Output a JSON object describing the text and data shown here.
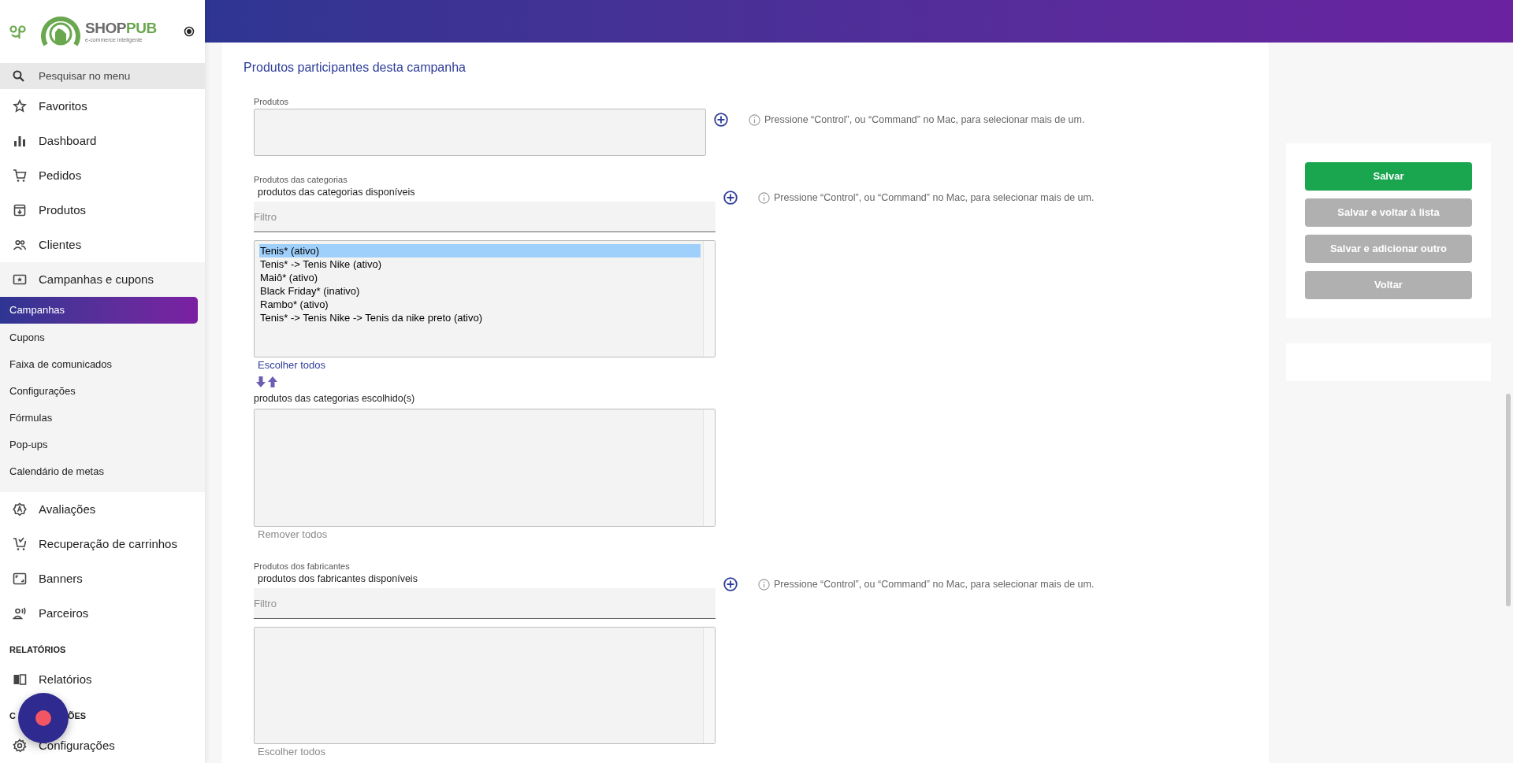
{
  "brand": {
    "name_parts": [
      {
        "text": "SHOP",
        "color": "#6b6b6b"
      },
      {
        "text": "PUB",
        "color": "#6aa84f"
      }
    ],
    "tagline": "e-commerce inteligente"
  },
  "sidebar": {
    "search_placeholder": "Pesquisar no menu",
    "entries": [
      {
        "kind": "item",
        "label": "Favoritos"
      },
      {
        "kind": "item",
        "label": "Dashboard"
      },
      {
        "kind": "item",
        "label": "Pedidos"
      },
      {
        "kind": "item",
        "label": "Produtos"
      },
      {
        "kind": "item",
        "label": "Clientes"
      },
      {
        "kind": "item",
        "label": "Campanhas e cupons",
        "expanded": true,
        "children": [
          {
            "label": "Campanhas",
            "selected": true
          },
          {
            "label": "Cupons",
            "selected": false
          },
          {
            "label": "Faixa de comunicados",
            "selected": false
          },
          {
            "label": "Configurações",
            "selected": false
          },
          {
            "label": "Fórmulas",
            "selected": false
          },
          {
            "label": "Pop-ups",
            "selected": false
          },
          {
            "label": "Calendário de metas",
            "selected": false
          }
        ]
      },
      {
        "kind": "item",
        "label": "Avaliações"
      },
      {
        "kind": "item",
        "label": "Recuperação de carrinhos"
      },
      {
        "kind": "item",
        "label": "Banners"
      },
      {
        "kind": "item",
        "label": "Parceiros"
      },
      {
        "kind": "section",
        "label_parts": [
          "RELATÓRIOS"
        ]
      },
      {
        "kind": "item",
        "label": "Relatórios"
      },
      {
        "kind": "section",
        "label_parts": [
          "C",
          "ÕES"
        ]
      },
      {
        "kind": "item",
        "label": "Configurações"
      }
    ]
  },
  "form": {
    "title": "Produtos participantes desta campanha",
    "fields": [
      {
        "kind": "multi",
        "label": "Produtos",
        "hint": "Pressione “Control”, ou “Command” no Mac, para selecionar mais de um."
      },
      {
        "kind": "dual",
        "label": "Produtos das categorias",
        "hint": "Pressione “Control”, ou “Command” no Mac, para selecionar mais de um.",
        "available_title": "produtos das categorias disponíveis",
        "filter_placeholder": "Filtro",
        "options": [
          {
            "text": "Tenis* (ativo)",
            "selected": true
          },
          {
            "text": "Tenis* -> Tenis Nike (ativo)",
            "selected": false
          },
          {
            "text": "Maiô* (ativo)",
            "selected": false
          },
          {
            "text": "Black Friday* (inativo)",
            "selected": false
          },
          {
            "text": "Rambo* (ativo)",
            "selected": false
          },
          {
            "text": "Tenis* -> Tenis Nike -> Tenis da nike preto (ativo)",
            "selected": false
          }
        ],
        "choose_all": {
          "text": "Escolher todos",
          "disabled": false
        },
        "chosen_title": "produtos das categorias escolhido(s)",
        "remove_all": {
          "text": "Remover todos",
          "disabled": true
        }
      },
      {
        "kind": "dual",
        "label": "Produtos dos fabricantes",
        "hint": "Pressione “Control”, ou “Command” no Mac, para selecionar mais de um.",
        "available_title": "produtos dos fabricantes disponíveis",
        "filter_placeholder": "Filtro",
        "choose_all": {
          "text": "Escolher todos",
          "disabled": true
        }
      }
    ]
  },
  "actions": [
    {
      "label": "Salvar",
      "kind": "primary"
    },
    {
      "label": "Salvar e voltar à lista",
      "kind": "secondary"
    },
    {
      "label": "Salvar e adicionar outro",
      "kind": "secondary"
    },
    {
      "label": "Voltar",
      "kind": "secondary"
    }
  ]
}
